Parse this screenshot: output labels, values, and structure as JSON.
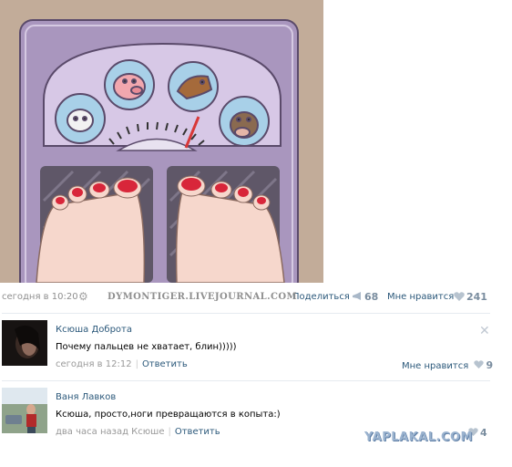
{
  "post": {
    "image_watermark": "DYMONTIGER.LIVEJOURNAL.COM",
    "time": "сегодня в 10:20",
    "share_label": "Поделиться",
    "share_count": "68",
    "like_label": "Мне нравится",
    "like_count": "241"
  },
  "comments": [
    {
      "author": "Ксюша Доброта",
      "text": "Почему пальцев не хватает, блин)))))",
      "time": "сегодня в 12:12",
      "reply_label": "Ответить",
      "like_label": "Мне нравится",
      "like_count": "9"
    },
    {
      "author": "Ваня Лавков",
      "text": "Ксюша, просто,ноги превращаются в копыта:)",
      "time": "два часа назад Ксюше",
      "reply_label": "Ответить",
      "like_count": "4"
    }
  ],
  "site_watermark": "YAPLAKAL.COM",
  "colors": {
    "link": "#2b587a",
    "muted": "#999999",
    "scale_body": "#a996be",
    "background_wall": "#c2ac99"
  },
  "icons": [
    "gear-icon",
    "megaphone-icon",
    "heart-icon",
    "close-icon"
  ]
}
